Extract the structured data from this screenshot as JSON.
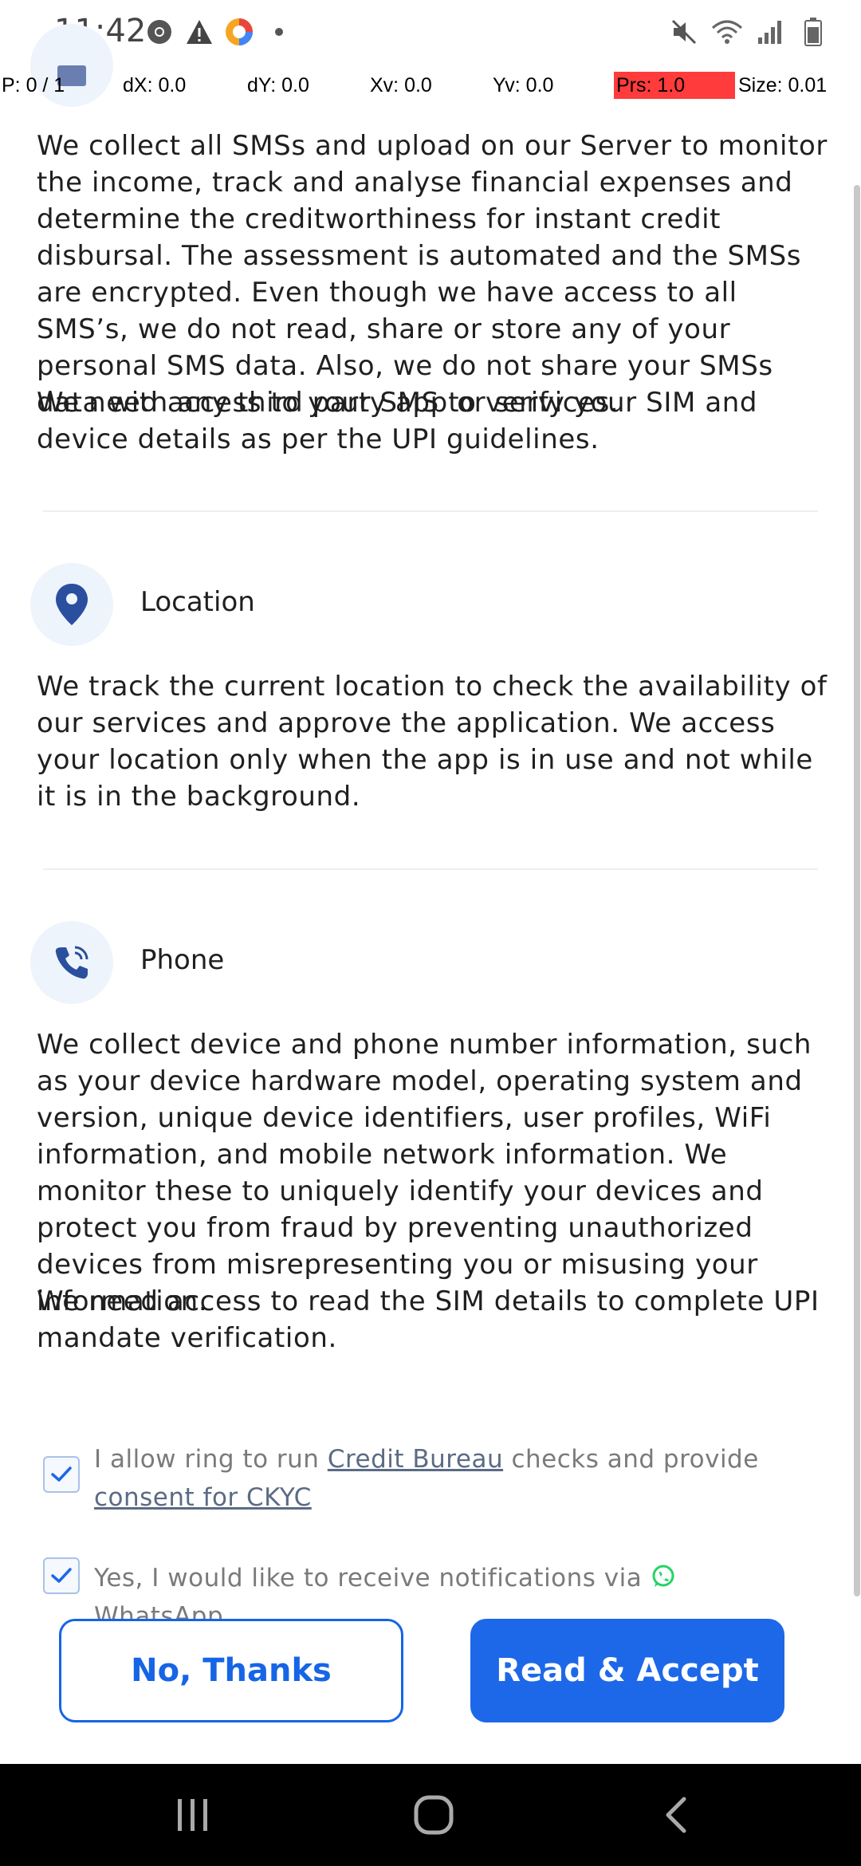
{
  "status_bar": {
    "time": "11:42",
    "left_icons": [
      "chrome-icon",
      "warning-icon",
      "app-icon",
      "dot-icon"
    ],
    "right_icons": [
      "mute-icon",
      "wifi-icon",
      "signal-icon",
      "battery-icon"
    ]
  },
  "debug": {
    "p": "P: 0 / 1",
    "dx": "dX: 0.0",
    "dy": "dY: 0.0",
    "xv": "Xv: 0.0",
    "yv": "Yv: 0.0",
    "prs": "Prs: 1.0",
    "size": "Size: 0.01"
  },
  "sms": {
    "description": "We collect all SMSs and upload on our Server to monitor the income, track and analyse financial expenses and determine the creditworthiness for instant credit disbursal. The assessment is automated and the SMSs are encrypted. Even though we have access to all SMS’s, we do not read, share or store any of your personal SMS data. Also, we do not share your SMSs data with any third party app or services.",
    "description_2": "We need access to your SMS to verify your SIM and device details as per the UPI guidelines."
  },
  "location": {
    "title": "Location",
    "icon": "location-pin-icon",
    "description": "We track the current location to check the availability of our services and approve the application. We access your location only when the app is in use and not while it is in the background."
  },
  "phone": {
    "title": "Phone",
    "icon": "phone-call-icon",
    "description": "We collect device and phone number information, such as your device hardware model, operating system and version, unique device identifiers, user profiles, WiFi information, and mobile network information. We monitor these to uniquely identify your devices and protect you from fraud by preventing unauthorized devices from misrepresenting you or misusing your information.",
    "description_2": "We need access to read the SIM details to complete UPI mandate verification."
  },
  "consent": {
    "credit_prefix": "I allow ring to run",
    "credit_link": "Credit Bureau",
    "credit_middle": "checks and provide",
    "ckyc_link": "consent for CKYC",
    "whatsapp_prefix": "Yes, I would like to receive notifications via",
    "whatsapp_label": "WhatsApp",
    "credit_checked": true,
    "whatsapp_checked": true
  },
  "buttons": {
    "decline": "No, Thanks",
    "accept": "Read & Accept"
  },
  "colors": {
    "primary": "#1d68e8",
    "icon_bg": "#eef4fc",
    "icon_fg": "#2a4f9e",
    "whatsapp": "#25d366",
    "pressure": "#ff3b3b"
  }
}
